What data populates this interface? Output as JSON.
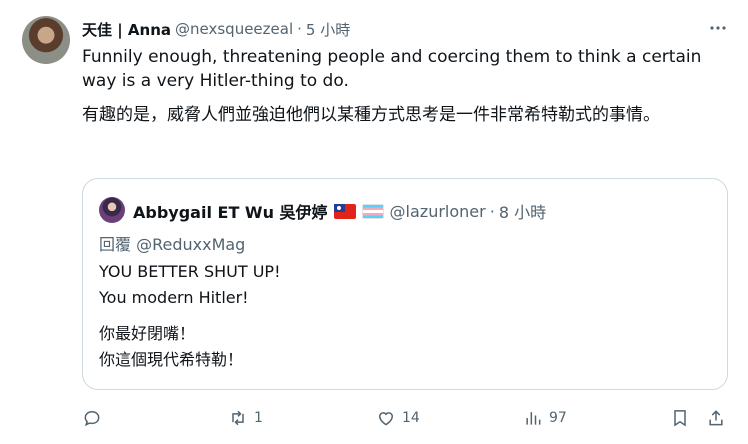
{
  "tweet": {
    "author_name": "天佳 | Anna",
    "author_handle": "@nexsqueezeal",
    "separator": "·",
    "time": "5 小時",
    "more_label": "···",
    "text_en": "Funnily enough, threatening people and coercing them to think a certain way is a very Hitler-thing to do.",
    "text_zh": "有趣的是，威脅人們並強迫他們以某種方式思考是一件非常希特勒式的事情。"
  },
  "quote": {
    "author_name": "Abbygail ET Wu 吳伊婷",
    "author_handle": "@lazurloner",
    "separator": "·",
    "time": "8 小時",
    "reply_to": "回覆 @ReduxxMag",
    "line1": "YOU BETTER SHUT UP!",
    "line2": "You modern Hitler!",
    "line3": "你最好閉嘴！",
    "line4": "你這個現代希特勒！"
  },
  "actions": {
    "reply_count": "",
    "retweet_count": "1",
    "like_count": "14",
    "views_count": "97"
  }
}
